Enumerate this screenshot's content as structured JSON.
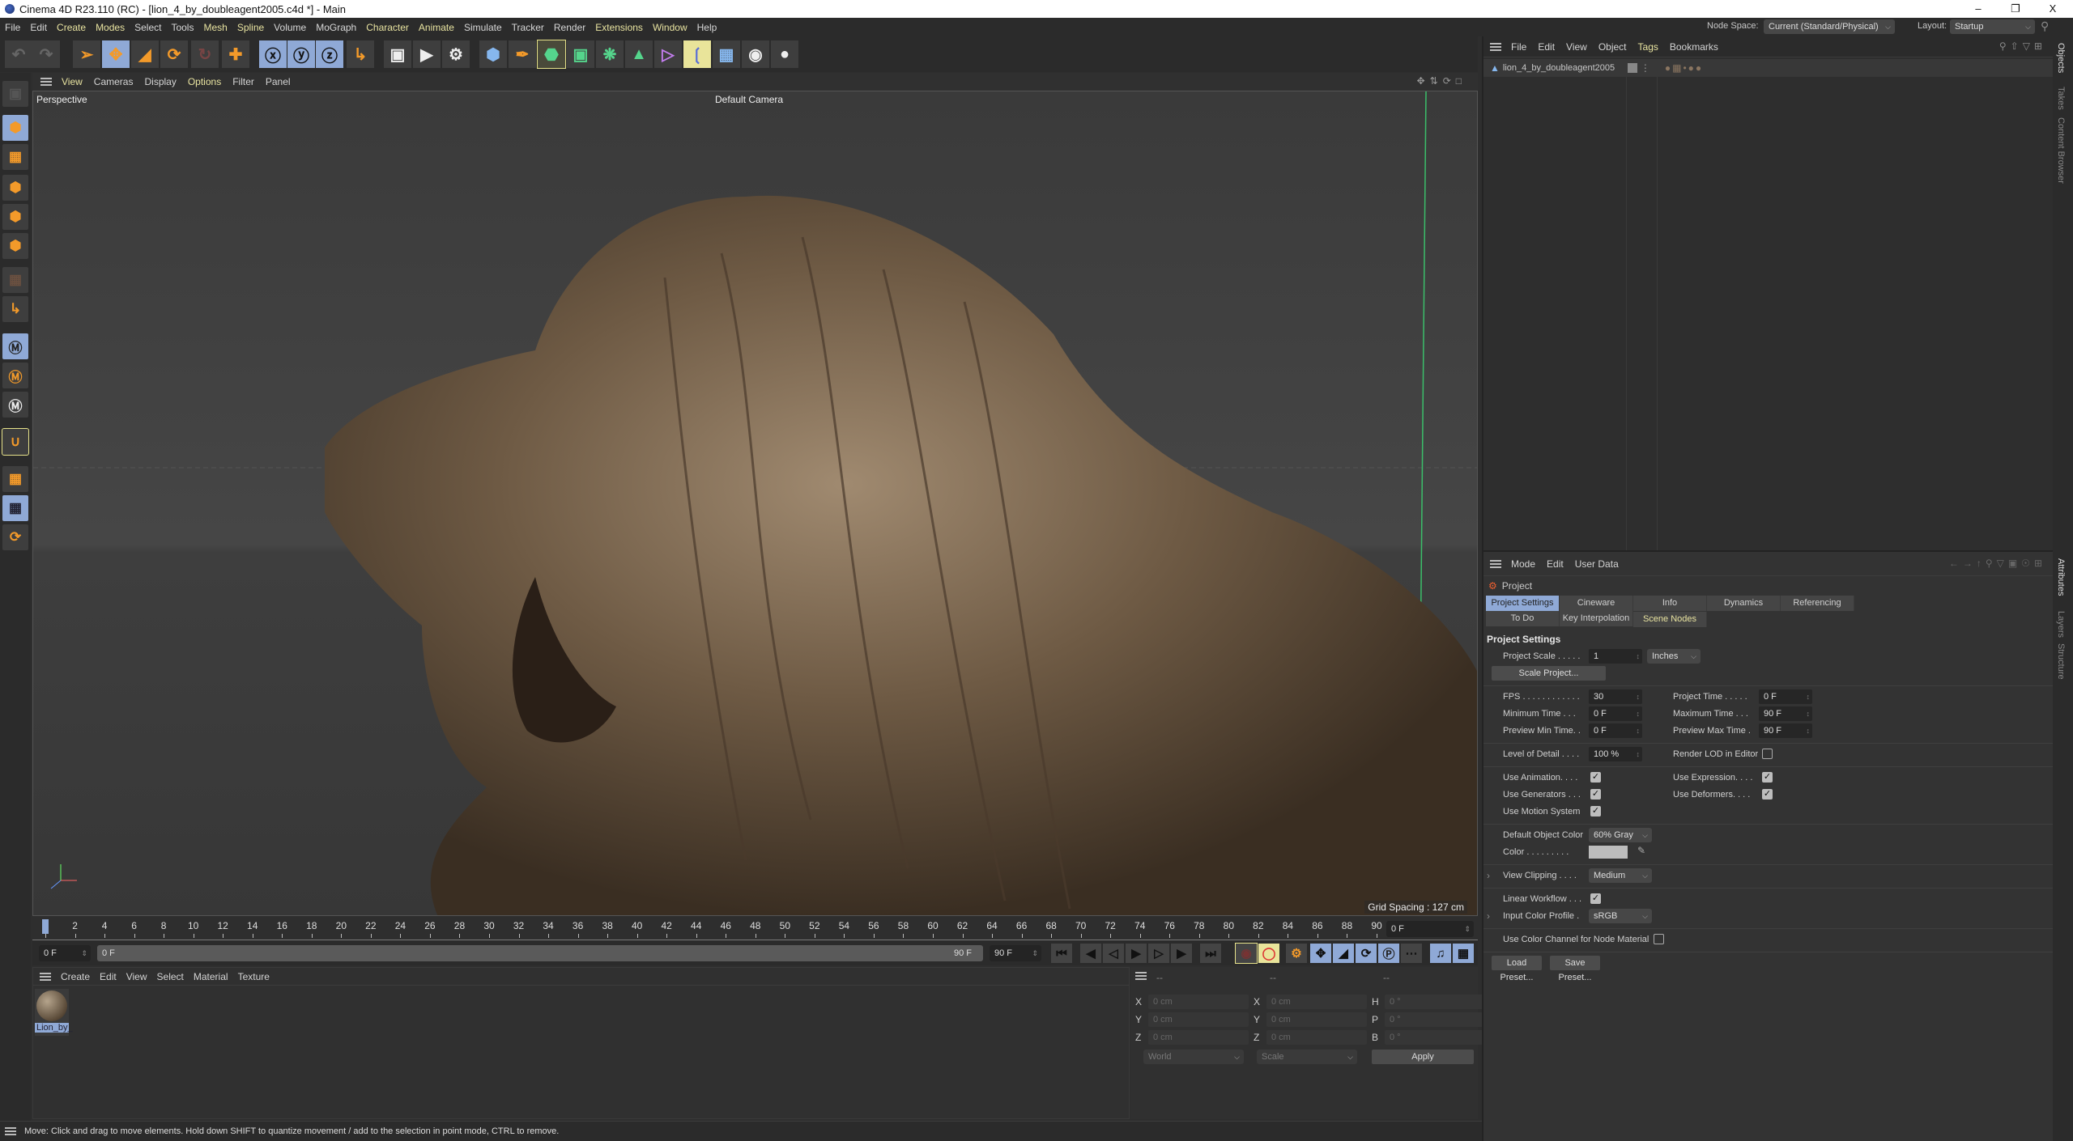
{
  "window": {
    "title": "Cinema 4D R23.110 (RC) - [lion_4_by_doubleagent2005.c4d *] - Main",
    "minimize": "–",
    "restore": "❐",
    "close": "X"
  },
  "menu": [
    "File",
    "Edit",
    "Create",
    "Modes",
    "Select",
    "Tools",
    "Mesh",
    "Spline",
    "Volume",
    "MoGraph",
    "Character",
    "Animate",
    "Simulate",
    "Tracker",
    "Render",
    "Extensions",
    "Window",
    "Help"
  ],
  "node_space": {
    "label": "Node Space:",
    "value": "Current (Standard/Physical)"
  },
  "layout": {
    "label": "Layout:",
    "value": "Startup"
  },
  "toolbar_icons": [
    "undo-icon",
    "redo-icon",
    "live-selection-icon",
    "move-icon",
    "scale-icon",
    "rotate-icon",
    "psr-icon",
    "move-recent-icon",
    "x-axis-icon",
    "y-axis-icon",
    "z-axis-icon",
    "world-coordinates-icon",
    "render-view-icon",
    "render-picture-viewer-icon",
    "render-settings-icon",
    "cube-icon",
    "pen-icon",
    "subdivision-icon",
    "extrude-icon",
    "cloner-icon",
    "boole-icon",
    "symmetry-icon",
    "bend-deformer-icon",
    "floor-icon",
    "camera-icon",
    "light-icon"
  ],
  "viewport": {
    "menu": [
      "View",
      "Cameras",
      "Display",
      "Options",
      "Filter",
      "Panel"
    ],
    "projection": "Perspective",
    "camera": "Default Camera",
    "grid_spacing": "Grid Spacing : 127 cm"
  },
  "timeline": {
    "start": 0,
    "end": 90,
    "step": 2,
    "current_frame": "0 F",
    "range_start": "0 F",
    "range_bar_start": "0 F",
    "range_bar_end": "90 F",
    "range_end": "90 F",
    "frame_field": "0 F"
  },
  "material_manager": {
    "menu": [
      "Create",
      "Edit",
      "View",
      "Select",
      "Material",
      "Texture"
    ],
    "materials": [
      {
        "name": "Lion_by_"
      }
    ]
  },
  "coordinates": {
    "headers": [
      "--",
      "--",
      "--"
    ],
    "pos": [
      {
        "axis": "X",
        "value": "0 cm"
      },
      {
        "axis": "Y",
        "value": "0 cm"
      },
      {
        "axis": "Z",
        "value": "0 cm"
      }
    ],
    "size": [
      {
        "axis": "X",
        "value": "0 cm"
      },
      {
        "axis": "Y",
        "value": "0 cm"
      },
      {
        "axis": "Z",
        "value": "0 cm"
      }
    ],
    "rot": [
      {
        "axis": "H",
        "value": "0 °"
      },
      {
        "axis": "P",
        "value": "0 °"
      },
      {
        "axis": "B",
        "value": "0 °"
      }
    ],
    "mode1": "World",
    "mode2": "Scale",
    "apply": "Apply"
  },
  "status": "Move: Click and drag to move elements. Hold down SHIFT to quantize movement / add to the selection in point mode, CTRL to remove.",
  "objects": {
    "menu": [
      "File",
      "Edit",
      "View",
      "Object",
      "Tags",
      "Bookmarks"
    ],
    "items": [
      {
        "name": "lion_4_by_doubleagent2005"
      }
    ]
  },
  "attributes": {
    "menu": [
      "Mode",
      "Edit",
      "User Data"
    ],
    "object": "Project",
    "tabs": [
      "Project Settings",
      "Cineware",
      "Info",
      "Dynamics",
      "Referencing",
      "To Do",
      "Key Interpolation",
      "Scene Nodes"
    ],
    "section": "Project Settings",
    "project_scale": {
      "label": "Project Scale . . . . .",
      "value": "1",
      "unit": "Inches"
    },
    "scale_project": "Scale Project...",
    "fps": {
      "label": "FPS . . . . . . . . . . . .",
      "value": "30"
    },
    "project_time": {
      "label": "Project Time . . . . .",
      "value": "0 F"
    },
    "min_time": {
      "label": "Minimum Time . . .",
      "value": "0 F"
    },
    "max_time": {
      "label": "Maximum Time . . .",
      "value": "90 F"
    },
    "preview_min": {
      "label": "Preview Min Time. .",
      "value": "0 F"
    },
    "preview_max": {
      "label": "Preview Max Time .",
      "value": "90 F"
    },
    "lod": {
      "label": "Level of Detail . . . .",
      "value": "100 %"
    },
    "render_lod": {
      "label": "Render LOD in Editor",
      "checked": false
    },
    "use_animation": {
      "label": "Use Animation. . . .",
      "checked": true
    },
    "use_expression": {
      "label": "Use Expression. . . .",
      "checked": true
    },
    "use_generators": {
      "label": "Use Generators . . .",
      "checked": true
    },
    "use_deformers": {
      "label": "Use Deformers. . . .",
      "checked": true
    },
    "use_motion": {
      "label": "Use Motion System",
      "checked": true
    },
    "default_color": {
      "label": "Default Object Color",
      "value": "60% Gray"
    },
    "color": {
      "label": "Color . . . . . . . . .",
      "swatch": "#bdbdbd"
    },
    "view_clipping": {
      "label": "View Clipping . . . .",
      "value": "Medium"
    },
    "linear_workflow": {
      "label": "Linear Workflow . . .",
      "checked": true
    },
    "input_profile": {
      "label": "Input Color Profile .",
      "value": "sRGB"
    },
    "use_color_channel": {
      "label": "Use Color Channel for Node Material",
      "checked": false
    },
    "load_preset": "Load Preset...",
    "save_preset": "Save Preset..."
  },
  "side_tabs": [
    "Objects",
    "Takes",
    "Content Browser",
    "Attributes",
    "Layers",
    "Structure"
  ],
  "colors": {
    "accent": "#8fa9d6",
    "orange": "#f39a2a",
    "highlight": "#e9e49a"
  }
}
